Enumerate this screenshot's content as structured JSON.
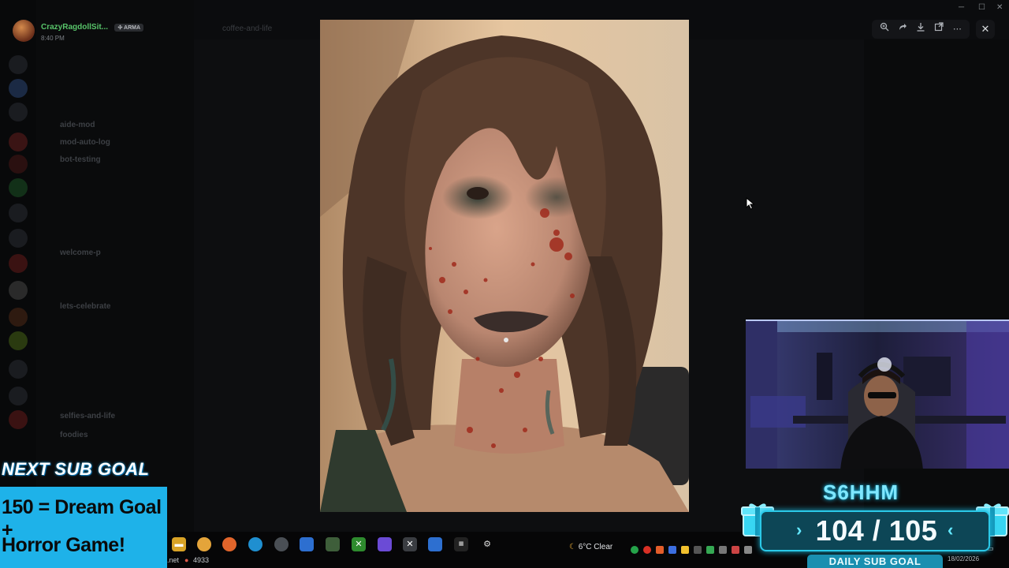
{
  "app": {
    "window_title": "",
    "channel_title": "coffee-and-life",
    "user": {
      "name": "CrazyRagdollSit...",
      "badge": "ARMA",
      "time": "8:40 PM"
    },
    "channels": [
      {
        "label": "aide-mod",
        "bold": true
      },
      {
        "label": "mod-auto-log",
        "bold": true
      },
      {
        "label": "bot-testing",
        "bold": true
      },
      {
        "label": "welcome-p",
        "bold": true
      },
      {
        "label": "lets-celebrate",
        "bold": true
      },
      {
        "label": "selfies-and-life",
        "bold": true
      },
      {
        "label": "foodies",
        "bold": true
      }
    ]
  },
  "viewer": {
    "tools": [
      "zoom-in",
      "forward",
      "download",
      "open-external",
      "more"
    ],
    "close_label": "✕"
  },
  "overlay": {
    "next_goal_title": "NEXT SUB GOAL",
    "goal_line1": "150 = Dream Goal +",
    "goal_line2": "Horror Game!",
    "sub_name": "S6HHM",
    "sub_count": "104 / 105",
    "sub_current": 104,
    "sub_target": 105,
    "daily_label": "DAILY SUB GOAL"
  },
  "taskbar": {
    "left_text": ".net",
    "counter": "4933",
    "weather": "6°C  Clear",
    "date": "18/02/2026"
  },
  "colors": {
    "goal_blue": "#1eb2e9",
    "sub_cyan": "#7fe7ff",
    "username_green": "#58c46a"
  }
}
